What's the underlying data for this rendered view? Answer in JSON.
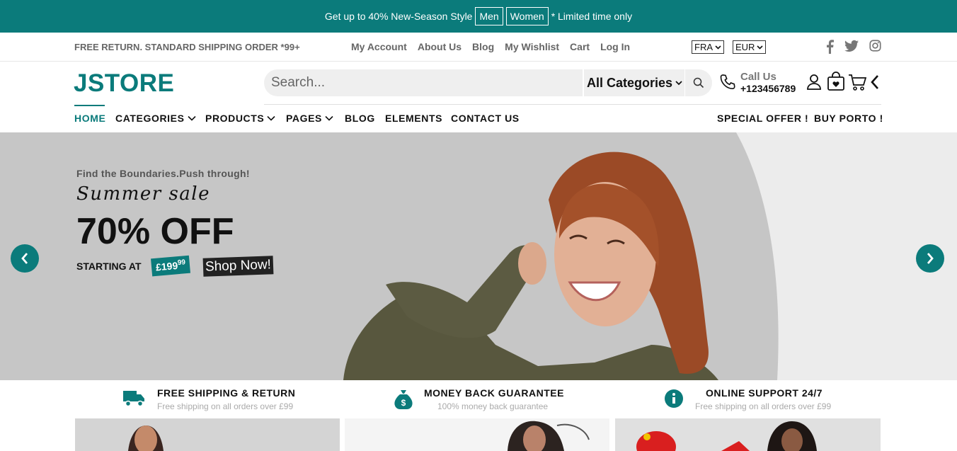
{
  "promo": {
    "text": "Get up to 40% New-Season Style",
    "men": "Men",
    "women": "Women",
    "limited": "* Limited time only"
  },
  "topbar": {
    "shipping": "FREE RETURN. STANDARD SHIPPING ORDER *99+",
    "links": [
      "My Account",
      "About Us",
      "Blog",
      "My Wishlist",
      "Cart",
      "Log In"
    ],
    "language": "FRA",
    "currency": "EUR",
    "social": [
      "facebook-icon",
      "twitter-icon",
      "instagram-icon"
    ]
  },
  "header": {
    "logo": "JSTORE",
    "search_placeholder": "Search...",
    "category": "All Categories",
    "call_label": "Call Us",
    "phone": "+123456789"
  },
  "nav": {
    "left": [
      "HOME",
      "CATEGORIES",
      "PRODUCTS",
      "PAGES",
      "BLOG",
      "ELEMENTS",
      "CONTACT US"
    ],
    "right": [
      "SPECIAL OFFER !",
      "BUY PORTO !"
    ]
  },
  "hero": {
    "tagline": "Find the Boundaries.Push through!",
    "script": "Summer sale",
    "headline": "70% OFF",
    "starting": "STARTING AT",
    "price": "£199",
    "price_cents": "99",
    "cta": "Shop Now!"
  },
  "services": [
    {
      "title": "FREE SHIPPING & RETURN",
      "subtitle": "Free shipping on all orders over £99",
      "icon": "truck-icon"
    },
    {
      "title": "MONEY BACK GUARANTEE",
      "subtitle": "100% money back guarantee",
      "icon": "money-bag-icon"
    },
    {
      "title": "ONLINE SUPPORT 24/7",
      "subtitle": "Free shipping on all orders over £99",
      "icon": "info-icon"
    }
  ],
  "colors": {
    "accent": "#0b7b7b",
    "hero_bg": "#c6c6c6"
  }
}
